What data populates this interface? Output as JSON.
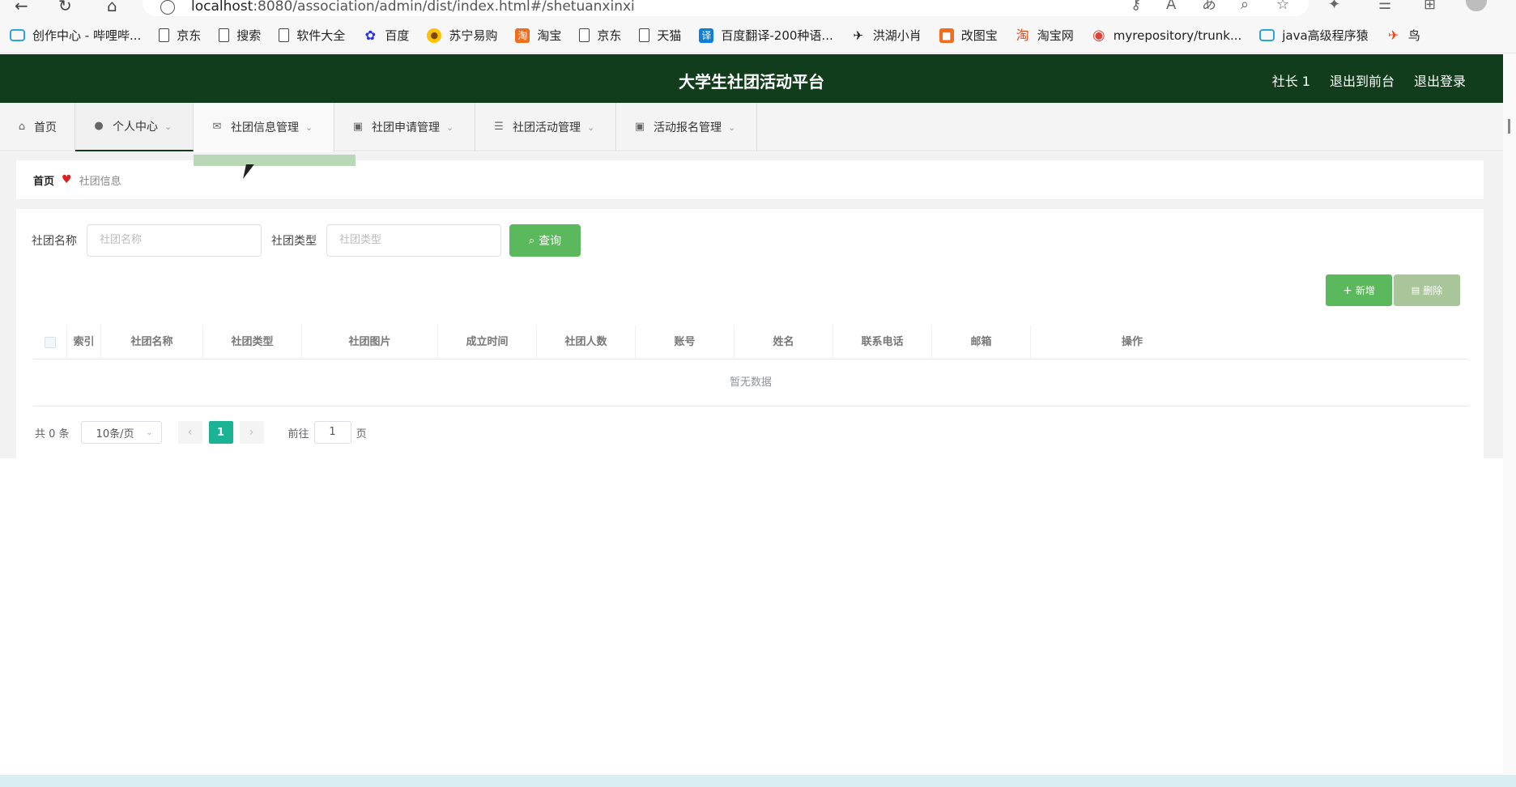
{
  "browser": {
    "url_host": "localhost",
    "url_rest": ":8080/association/admin/dist/index.html#/shetuanxinxi",
    "bookmarks": [
      {
        "label": "创作中心 - 哔哩哔...",
        "icon": "bilibili-icon"
      },
      {
        "label": "京东",
        "icon": "page-icon"
      },
      {
        "label": "搜索",
        "icon": "page-icon"
      },
      {
        "label": "软件大全",
        "icon": "page-icon"
      },
      {
        "label": "百度",
        "icon": "baidu-icon"
      },
      {
        "label": "苏宁易购",
        "icon": "suning-icon"
      },
      {
        "label": "淘宝",
        "icon": "taobao-icon"
      },
      {
        "label": "京东",
        "icon": "page-icon"
      },
      {
        "label": "天猫",
        "icon": "page-icon"
      },
      {
        "label": "百度翻译-200种语...",
        "icon": "translate-icon"
      },
      {
        "label": "洪湖小肖",
        "icon": "bird-icon"
      },
      {
        "label": "改图宝",
        "icon": "orange-icon"
      },
      {
        "label": "淘宝网",
        "icon": "taobao-icon"
      },
      {
        "label": "myrepository/trunk...",
        "icon": "chrome-icon"
      },
      {
        "label": "java高级程序猿",
        "icon": "bilibili-icon"
      },
      {
        "label": "鸟",
        "icon": "bird-red-icon"
      }
    ]
  },
  "header": {
    "title": "大学生社团活动平台",
    "user": "社长 1",
    "back_to_front": "退出到前台",
    "logout": "退出登录"
  },
  "menu": [
    {
      "label": "首页",
      "icon": "home-icon",
      "has_chevron": false
    },
    {
      "label": "个人中心",
      "icon": "user-icon",
      "has_chevron": true
    },
    {
      "label": "社团信息管理",
      "icon": "mail-icon",
      "has_chevron": true
    },
    {
      "label": "社团申请管理",
      "icon": "clipboard-icon",
      "has_chevron": true
    },
    {
      "label": "社团活动管理",
      "icon": "list-icon",
      "has_chevron": true
    },
    {
      "label": "活动报名管理",
      "icon": "clipboard-icon",
      "has_chevron": true
    }
  ],
  "breadcrumb": {
    "home": "首页",
    "current": "社团信息"
  },
  "search": {
    "name_label": "社团名称",
    "name_placeholder": "社团名称",
    "type_label": "社团类型",
    "type_placeholder": "社团类型",
    "query_button": "查询"
  },
  "actions": {
    "add": "新增",
    "delete": "删除"
  },
  "table": {
    "columns": [
      "索引",
      "社团名称",
      "社团类型",
      "社团图片",
      "成立时间",
      "社团人数",
      "账号",
      "姓名",
      "联系电话",
      "邮箱",
      "操作"
    ],
    "empty_text": "暂无数据"
  },
  "pagination": {
    "total": "共 0 条",
    "page_size": "10条/页",
    "current_page": "1",
    "goto_label": "前往",
    "goto_value": "1",
    "page_suffix": "页"
  },
  "colors": {
    "header_bg": "#123d1c",
    "primary_green": "#5cb85c",
    "page_active": "#1bb394",
    "delete_disabled": "#a9c59a"
  }
}
